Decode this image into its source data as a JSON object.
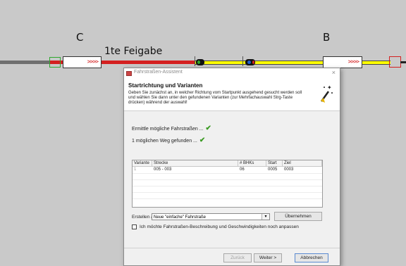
{
  "track": {
    "label_c": "C",
    "label_b": "B",
    "label_freigabe": "1te Feigabe",
    "block_arrows": ">>>>"
  },
  "dialog": {
    "title": "Fahrstraßen-Assistent",
    "close_label": "×",
    "header_title": "Startrichtung und Varianten",
    "header_desc": "Geben Sie zunächst an, in welcher Richtung vom Startpunkt ausgehend gesucht werden soll und wählen Sie dann unter den gefundenen Varianten (zur Mehrfachauswahl Strg-Taste drücken) während der auswahl!",
    "status1": "Ermittle mögliche Fahrstraßen ...",
    "status2": "1 möglichen Weg gefunden ...",
    "table": {
      "headers": [
        "Variante",
        "Strecke",
        "# BHKs",
        "Start",
        "Ziel"
      ],
      "rows": [
        [
          "1",
          "005 - 003",
          "06",
          "0005",
          "0003"
        ]
      ]
    },
    "create_label": "Erstellen als:",
    "create_value": "Neue \"einfache\" Fahrstraße",
    "override_button": "Übernehmen",
    "checkbox_label": "Ich möchte Fahrstraßen-Beschreibung und Geschwindigkeiten noch anpassen",
    "back_button": "Zurück",
    "next_button": "Weiter >",
    "cancel_button": "Abbrechen"
  },
  "colors": {
    "occupied_track": "#d42020",
    "free_track": "#ffff00",
    "idle_track": "#707070",
    "check": "#3a9a22"
  }
}
